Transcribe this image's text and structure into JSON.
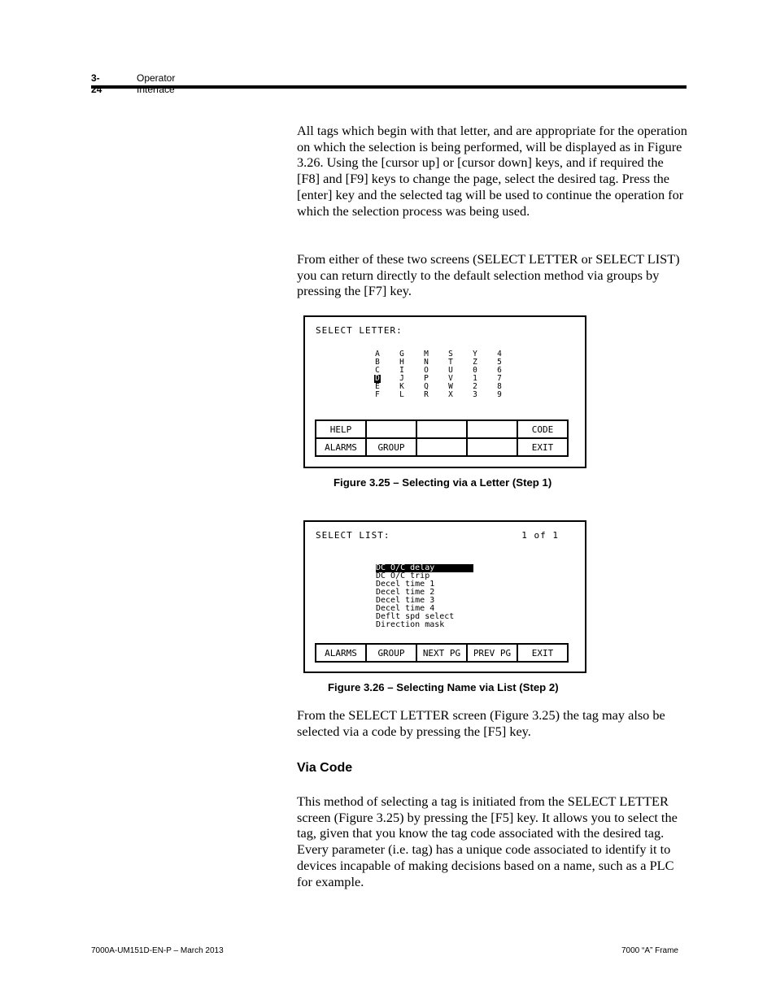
{
  "header": {
    "page_number": "3-24",
    "section_title": "Operator Interface"
  },
  "paragraphs": {
    "p1": "All tags which begin with that letter, and are appropriate for the operation on which the selection is being performed, will be displayed as in Figure 3.26.  Using the [cursor up] or [cursor down] keys, and if required the [F8] and [F9] keys to change the page, select the desired tag.  Press the [enter] key and the selected tag will be used to continue the operation for which the selection process was being used.",
    "p2": "From either of these two screens (SELECT LETTER or SELECT LIST) you can return directly to the default selection method via groups by pressing the [F7] key.",
    "p3": "From the SELECT LETTER screen (Figure 3.25) the tag may also be selected via a code by pressing the [F5] key.",
    "p4": "This method of selecting a tag is initiated from the SELECT LETTER screen (Figure 3.25) by pressing the [F5] key.  It allows you to select the tag, given that you know the tag code associated with the desired tag.  Every parameter (i.e. tag) has a unique code associated to identify it to devices incapable of making decisions based on a name, such as a PLC for example."
  },
  "heading_via_code": "Via Code",
  "figure1": {
    "caption": "Figure 3.25 – Selecting via a Letter (Step 1)",
    "screen_title": "SELECT LETTER:",
    "columns": [
      [
        "A",
        "B",
        "C",
        "D",
        "E",
        "F"
      ],
      [
        "G",
        "H",
        "I",
        "J",
        "K",
        "L"
      ],
      [
        "M",
        "N",
        "O",
        "P",
        "Q",
        "R"
      ],
      [
        "S",
        "T",
        "U",
        "V",
        "W",
        "X"
      ],
      [
        "Y",
        "Z",
        "0",
        "1",
        "2",
        "3"
      ],
      [
        "4",
        "5",
        "6",
        "7",
        "8",
        "9"
      ]
    ],
    "cursor_letter": "D",
    "fkeys_row1": [
      "HELP",
      "",
      "",
      "",
      "CODE"
    ],
    "fkeys_row2": [
      "ALARMS",
      "GROUP",
      "",
      "",
      "EXIT"
    ]
  },
  "figure2": {
    "caption": "Figure 3.26 – Selecting Name via List (Step 2)",
    "screen_title": "SELECT LIST:",
    "page_indicator": "1 of  1",
    "items": [
      "DC O/C delay",
      "DC O/C trip",
      "Decel time 1",
      "Decel time 2",
      "Decel time 3",
      "Decel time 4",
      "Deflt spd select",
      "Direction mask"
    ],
    "selected_index": 0,
    "fkeys": [
      "ALARMS",
      "GROUP",
      "NEXT PG",
      "PREV PG",
      "EXIT"
    ]
  },
  "footer": {
    "left": "7000A-UM151D-EN-P – March 2013",
    "right": "7000 “A” Frame"
  }
}
